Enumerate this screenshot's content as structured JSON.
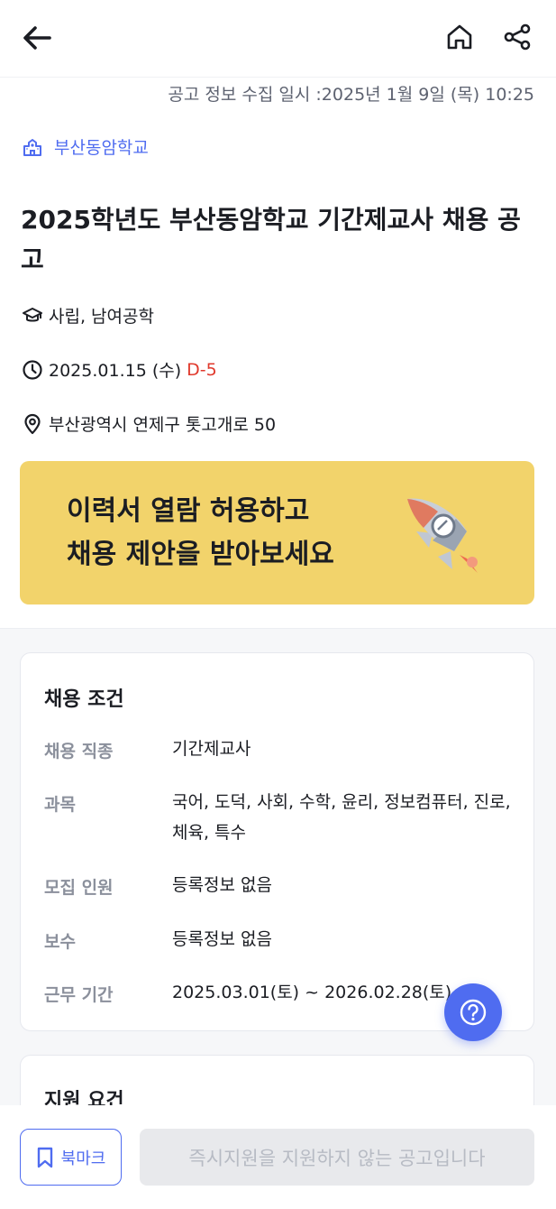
{
  "header": {
    "back_icon": "arrow-left-icon",
    "home_icon": "home-icon",
    "share_icon": "share-icon"
  },
  "collected_at": "공고 정보 수집 일시 :2025년 1월 9일 (목) 10:25",
  "school": {
    "icon": "school-building-icon",
    "name": "부산동암학교"
  },
  "title": "2025학년도 부산동암학교 기간제교사 채용 공고",
  "info": {
    "type": "사립, 남여공학",
    "deadline": "2025.01.15 (수)",
    "dday": "D-5",
    "address": "부산광역시 연제구 톳고개로 50"
  },
  "banner": {
    "line1": "이력서 열람 허용하고",
    "line2": "채용 제안을 받아보세요",
    "icon": "rocket-icon"
  },
  "conditions": {
    "title": "채용 조건",
    "rows": [
      {
        "label": "채용 직종",
        "value": "기간제교사"
      },
      {
        "label": "과목",
        "value": "국어, 도덕, 사회, 수학, 윤리, 정보컴퓨터, 진로, 체육, 특수"
      },
      {
        "label": "모집 인원",
        "value": "등록정보 없음"
      },
      {
        "label": "보수",
        "value": "등록정보 없음"
      },
      {
        "label": "근무 기간",
        "value": "2025.03.01(토) ~ 2026.02.28(토)"
      }
    ]
  },
  "requirements": {
    "title": "지원 요건"
  },
  "bottom": {
    "bookmark_label": "북마크",
    "apply_label": "즉시지원을 지원하지 않는 공고입니다"
  },
  "colors": {
    "accent": "#4f6cf0",
    "dday": "#e0392c",
    "banner_bg": "#f2d36b"
  }
}
